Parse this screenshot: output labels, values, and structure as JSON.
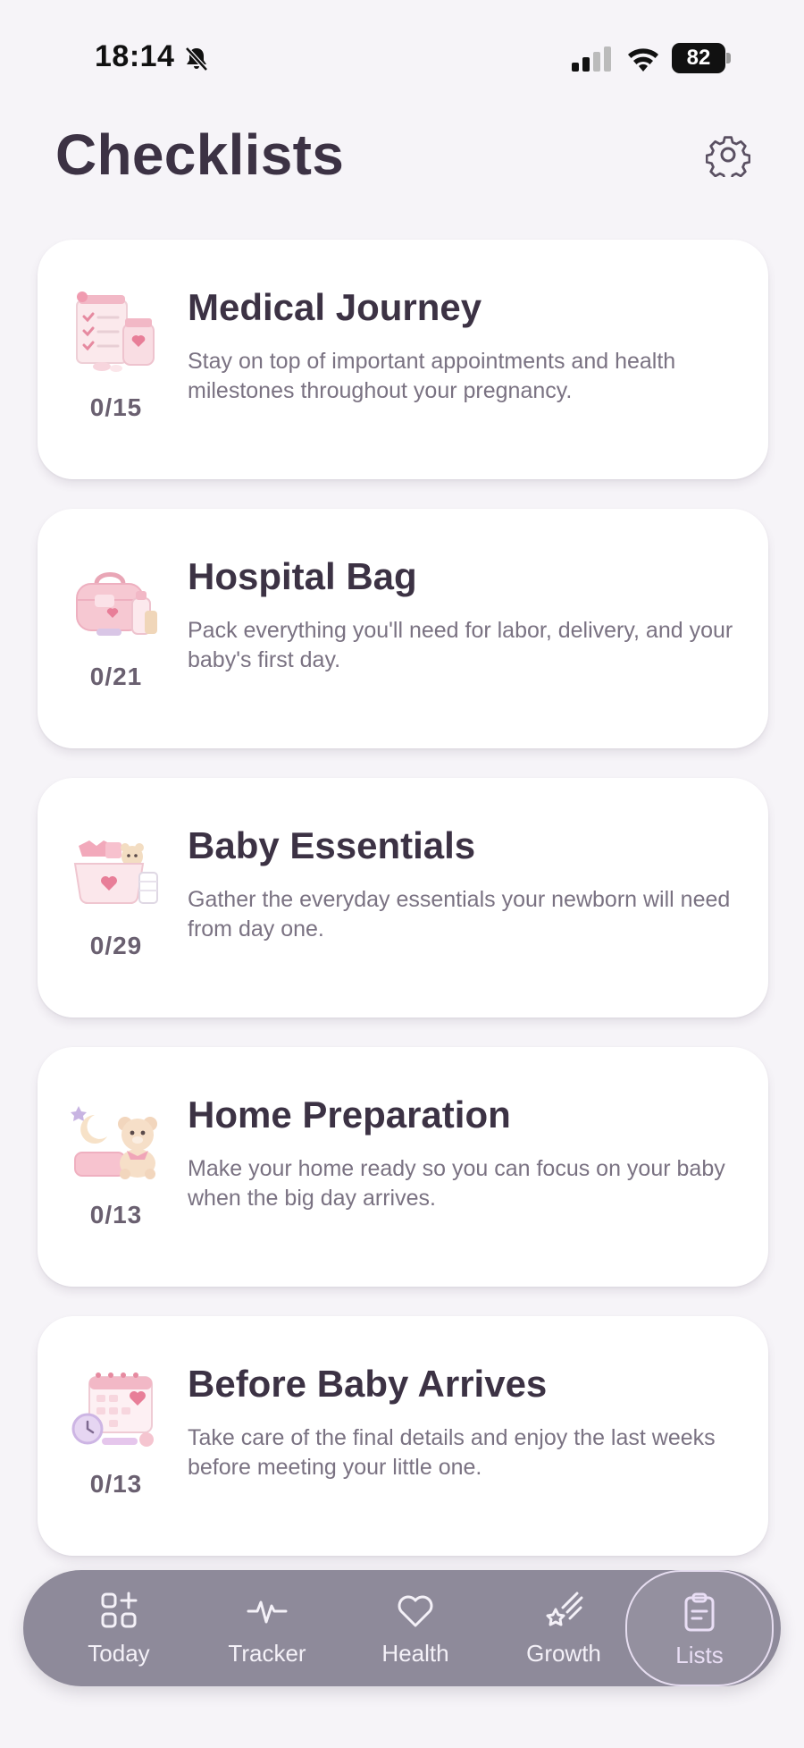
{
  "status_bar": {
    "time": "18:14",
    "battery": "82",
    "icons": [
      "bell-slash-icon",
      "cellular-signal-icon",
      "wifi-icon",
      "battery-icon"
    ]
  },
  "header": {
    "title": "Checklists",
    "settings_icon": "gear-icon"
  },
  "checklists": [
    {
      "title": "Medical Journey",
      "description": "Stay on top of important appointments and health milestones throughout your pregnancy.",
      "progress": "0/15",
      "illustration": "medical-clipboard-icon"
    },
    {
      "title": "Hospital Bag",
      "description": "Pack everything you'll need for labor, delivery, and your baby's first day.",
      "progress": "0/21",
      "illustration": "hospital-bag-icon"
    },
    {
      "title": "Baby Essentials",
      "description": "Gather the everyday essentials your newborn will need from day one.",
      "progress": "0/29",
      "illustration": "baby-basket-icon"
    },
    {
      "title": "Home Preparation",
      "description": "Make your home ready so you can focus on your baby when the big day arrives.",
      "progress": "0/13",
      "illustration": "teddy-bear-icon"
    },
    {
      "title": "Before Baby Arrives",
      "description": "Take care of the final details and enjoy the last weeks before meeting your little one.",
      "progress": "0/13",
      "illustration": "calendar-clock-icon"
    }
  ],
  "tab_bar": {
    "tabs": [
      {
        "label": "Today",
        "icon": "grid-plus-icon"
      },
      {
        "label": "Tracker",
        "icon": "pulse-icon"
      },
      {
        "label": "Health",
        "icon": "heart-icon"
      },
      {
        "label": "Growth",
        "icon": "shooting-star-icon"
      },
      {
        "label": "Lists",
        "icon": "clipboard-list-icon"
      }
    ],
    "active": "Lists"
  },
  "colors": {
    "background": "#f6f4f8",
    "card": "#ffffff",
    "title_text": "#3c3244",
    "muted_text": "#7a7282",
    "tab_bar": "#8e8a9a",
    "accent_pink": "#f2b8c6"
  }
}
